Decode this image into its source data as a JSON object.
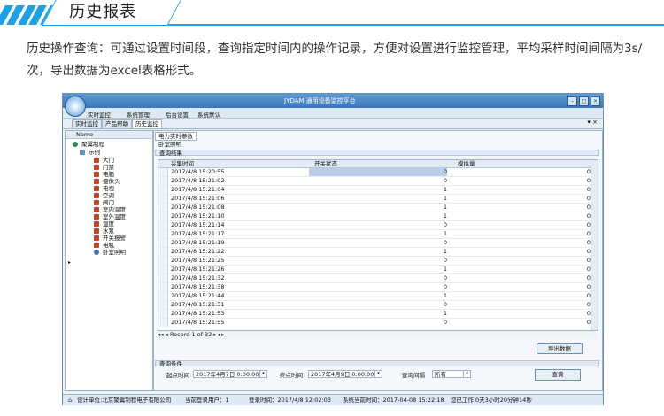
{
  "banner": {
    "title": "历史报表"
  },
  "description": "历史操作查询：可通过设置时间段，查询指定时间内的操作记录，方便对设置进行监控管理，平均采样时间间隔为3s/次，导出数据为excel表格形式。",
  "window": {
    "title": "JYDAM 通用设备监控平台"
  },
  "menu": [
    "实时监控",
    "系统管理",
    "后台设置",
    "系统默认"
  ],
  "tabs": [
    "实时监控",
    "产品帮助",
    "历史监控"
  ],
  "tree": {
    "header": "Name",
    "root": "聚翼制程",
    "child": "示例",
    "items": [
      "大门",
      "门禁",
      "电脑",
      "摄像头",
      "电视",
      "空调",
      "阀门",
      "室内温度",
      "室外温度",
      "湿度",
      "水泵",
      "开关报警",
      "电机",
      "卧室照明"
    ]
  },
  "panel": {
    "tab": "电力实时参数",
    "device": "卧室照明",
    "result_header": "查询结果",
    "columns": [
      "采集时间",
      "开关状态",
      "模拟量"
    ],
    "rows": [
      [
        "2017/4/8 15:20:55",
        "0",
        "0"
      ],
      [
        "2017/4/8 15:21:02",
        "0",
        "0"
      ],
      [
        "2017/4/8 15:21:04",
        "1",
        "0"
      ],
      [
        "2017/4/8 15:21:06",
        "1",
        "0"
      ],
      [
        "2017/4/8 15:21:08",
        "1",
        "0"
      ],
      [
        "2017/4/8 15:21:10",
        "1",
        "0"
      ],
      [
        "2017/4/8 15:21:14",
        "0",
        "0"
      ],
      [
        "2017/4/8 15:21:17",
        "1",
        "0"
      ],
      [
        "2017/4/8 15:21:19",
        "0",
        "0"
      ],
      [
        "2017/4/8 15:21:22",
        "1",
        "0"
      ],
      [
        "2017/4/8 15:21:25",
        "0",
        "0"
      ],
      [
        "2017/4/8 15:21:26",
        "1",
        "0"
      ],
      [
        "2017/4/8 15:21:32",
        "0",
        "0"
      ],
      [
        "2017/4/8 15:21:38",
        "0",
        "0"
      ],
      [
        "2017/4/8 15:21:44",
        "1",
        "0"
      ],
      [
        "2017/4/8 15:21:51",
        "0",
        "0"
      ],
      [
        "2017/4/8 15:21:53",
        "1",
        "0"
      ],
      [
        "2017/4/8 15:21:55",
        "0",
        "0"
      ]
    ],
    "record_text": "Record 1 of 32",
    "export_label": "导出数据",
    "query_header": "查询条件",
    "start_label": "起点时间",
    "start_value": "2017年4月7日 0:00:00",
    "end_label": "终点时间",
    "end_value": "2017年4月9日 0:00:00",
    "mode_label": "查询间隔",
    "mode_value": "所有",
    "query_label": "查询"
  },
  "status": {
    "company": "设计单位:北京聚翼制程电子有限公司",
    "users": "当前登录用户：1",
    "login_time": "登录时间：2017/4/8 12:02:03",
    "system_time": "系统当前时间：2017-04-08 15:22:18",
    "uptime_label": "您已工作：",
    "uptime": "0天3小时20分钟14秒"
  }
}
